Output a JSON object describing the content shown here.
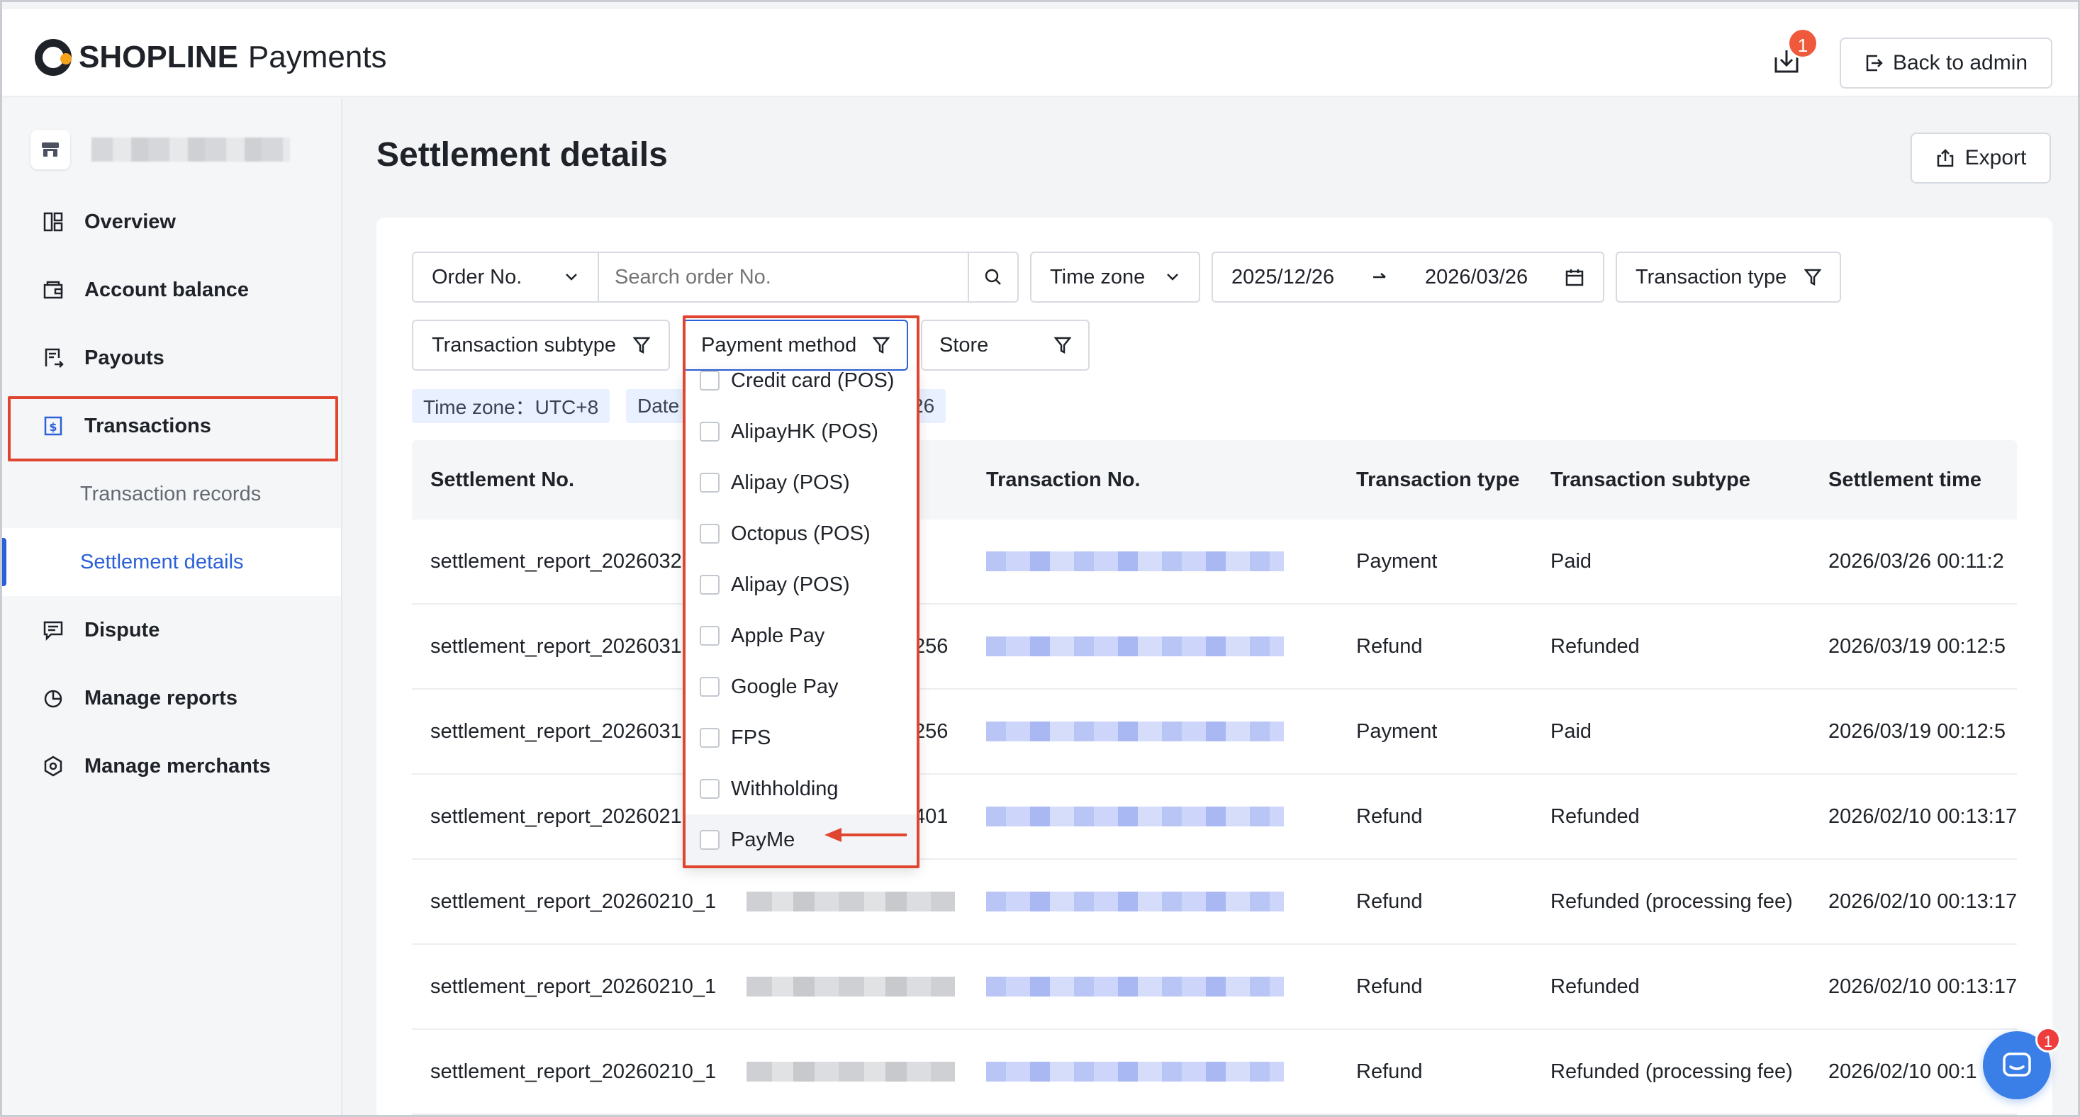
{
  "header": {
    "brand": "SHOPLINE",
    "product": "Payments",
    "download_badge": "1",
    "back_label": "Back to admin"
  },
  "sidebar": {
    "items": [
      {
        "label": "Overview",
        "icon": "overview-icon"
      },
      {
        "label": "Account balance",
        "icon": "wallet-icon"
      },
      {
        "label": "Payouts",
        "icon": "payout-icon"
      },
      {
        "label": "Transactions",
        "icon": "dollar-doc-icon"
      },
      {
        "label": "Dispute",
        "icon": "chat-doc-icon"
      },
      {
        "label": "Manage reports",
        "icon": "pie-chart-icon"
      },
      {
        "label": "Manage merchants",
        "icon": "hexagon-icon"
      }
    ],
    "sub_items": [
      "Transaction records",
      "Settlement details"
    ]
  },
  "main": {
    "title": "Settlement details",
    "export_label": "Export",
    "filters": {
      "order_select": "Order No.",
      "search_placeholder": "Search order No.",
      "time_zone_select": "Time zone",
      "date_start": "2025/12/26",
      "date_end": "2026/03/26",
      "transaction_type": "Transaction type",
      "transaction_subtype": "Transaction subtype",
      "payment_method": "Payment method",
      "store": "Store"
    },
    "tags": {
      "time_zone": "Time zone：UTC+8",
      "date_prefix": "Date",
      "date_suffix": "26"
    },
    "table": {
      "columns": [
        "Settlement No.",
        "Transaction No.",
        "Transaction type",
        "Transaction subtype",
        "Settlement time"
      ],
      "rows": [
        {
          "settlement_no": "settlement_report_2026032",
          "order_tail": "",
          "type": "Payment",
          "subtype": "Paid",
          "time": "2026/03/26 00:11:2"
        },
        {
          "settlement_no": "settlement_report_2026031",
          "order_tail": "256",
          "type": "Refund",
          "subtype": "Refunded",
          "time": "2026/03/19 00:12:5"
        },
        {
          "settlement_no": "settlement_report_2026031",
          "order_tail": "256",
          "type": "Payment",
          "subtype": "Paid",
          "time": "2026/03/19 00:12:5"
        },
        {
          "settlement_no": "settlement_report_2026021",
          "order_tail": "401",
          "type": "Refund",
          "subtype": "Refunded",
          "time": "2026/02/10 00:13:17"
        },
        {
          "settlement_no": "settlement_report_20260210_1",
          "order_tail": "",
          "type": "Refund",
          "subtype": "Refunded (processing fee)",
          "time": "2026/02/10 00:13:17"
        },
        {
          "settlement_no": "settlement_report_20260210_1",
          "order_tail": "",
          "type": "Refund",
          "subtype": "Refunded",
          "time": "2026/02/10 00:13:17"
        },
        {
          "settlement_no": "settlement_report_20260210_1",
          "order_tail": "",
          "type": "Refund",
          "subtype": "Refunded (processing fee)",
          "time": "2026/02/10 00:1"
        }
      ]
    },
    "payment_method_options": [
      "Credit card (POS)",
      "AlipayHK (POS)",
      "Alipay (POS)",
      "Octopus (POS)",
      "Alipay (POS)",
      "Apple Pay",
      "Google Pay",
      "FPS",
      "Withholding",
      "PayMe"
    ]
  },
  "chat": {
    "badge": "1"
  },
  "colors": {
    "accent": "#2a60d8",
    "highlight": "#e0462f",
    "badge": "#ef5a3c"
  }
}
